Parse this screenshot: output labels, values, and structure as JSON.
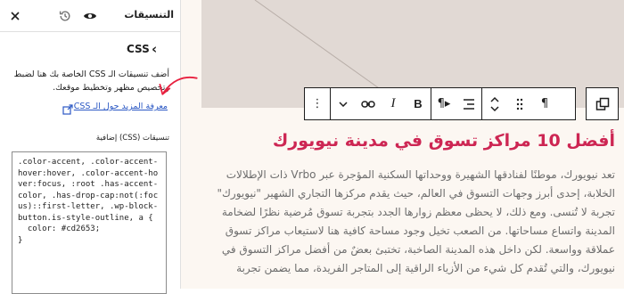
{
  "sidebar": {
    "title": "التنسيقات",
    "panel_title": "CSS",
    "description": "أضف تنسيقات الـ CSS الخاصة بك هنا لضبط وتخصيص مظهر وتخطيط موقعك.",
    "learn_more": "معرفة المزيد حول الـ CSS",
    "css_label": "تنسيقات (CSS) إضافية",
    "css_code": ".color-accent, .color-accent-hover:hover, .color-accent-hover:focus, :root .has-accent-color, .has-drop-cap:not(:focus)::first-letter, .wp-block-button.is-style-outline, a {\n  color: #cd2653;\n}",
    "icons": [
      "close-icon",
      "history-icon",
      "eye-icon",
      "chevron-left-icon",
      "external-link-icon"
    ]
  },
  "toolbar": {
    "buttons": [
      "more-options",
      "dropdown",
      "link",
      "italic",
      "bold",
      "text-direction",
      "align",
      "move-arrows",
      "drag-handle",
      "paragraph"
    ]
  },
  "content": {
    "heading": "أفضل 10 مراكز تسوق في مدينة نيويورك",
    "paragraph": "تعد نيويورك، موطنًا لفنادقها الشهيرة ووحداتها السكنية المؤجرة عبر Vrbo ذات الإطلالات الخلابة، إحدى أبرز وجهات التسوق في العالم، حيث يقدم مركزها التجاري الشهير \"نيويورك\" تجربة لا تُنسى. ومع ذلك، لا يحظى معظم زوارها الجدد بتجربة تسوق مُرضية نظرًا لضخامة المدينة واتساع مساحاتها. من الصعب تخيل وجود مساحة كافية هنا لاستيعاب مراكز تسوق عملاقة وواسعة. لكن داخل هذه المدينة الصاخبة، تختبئ بعضٌ من أفضل مراكز التسوق في نيويورك، والتي تُقدم كل شيء من الأزياء الراقية إلى المتاجر الفريدة، مما يضمن تجربة"
  },
  "colors": {
    "accent": "#cd2653",
    "canvas_bg": "#fcf7f2",
    "image_placeholder": "#e1d9d4"
  }
}
